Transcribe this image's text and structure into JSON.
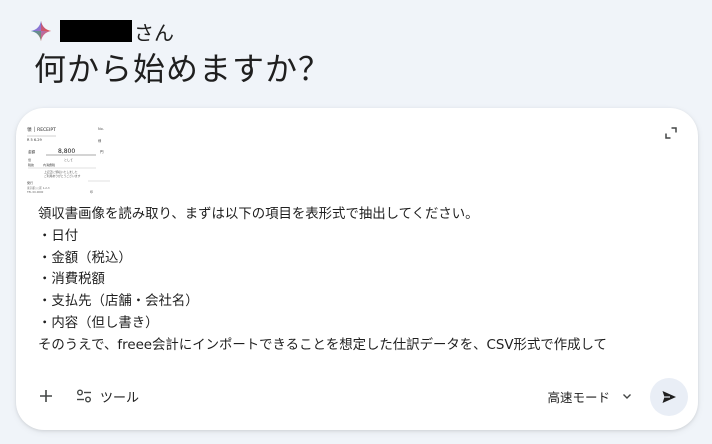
{
  "greeting": {
    "suffix": "さん",
    "headline": "何から始めますか？"
  },
  "composer": {
    "attachment": {
      "type": "receipt-image",
      "label": "RECEIPT",
      "amount": "8,800"
    },
    "prompt_lines": [
      "領収書画像を読み取り、まずは以下の項目を表形式で抽出してください。",
      "・日付",
      "・金額（税込）",
      "・消費税額",
      "・支払先（店舗・会社名）",
      "・内容（但し書き）",
      "そのうえで、freee会計にインポートできることを想定した仕訳データを、CSV形式で作成して"
    ],
    "tools_label": "ツール",
    "mode_label": "高速モード"
  },
  "colors": {
    "background": "#f0f4f9",
    "card": "#ffffff",
    "text": "#1f1f1f",
    "send_button_bg": "#e9eef6"
  }
}
